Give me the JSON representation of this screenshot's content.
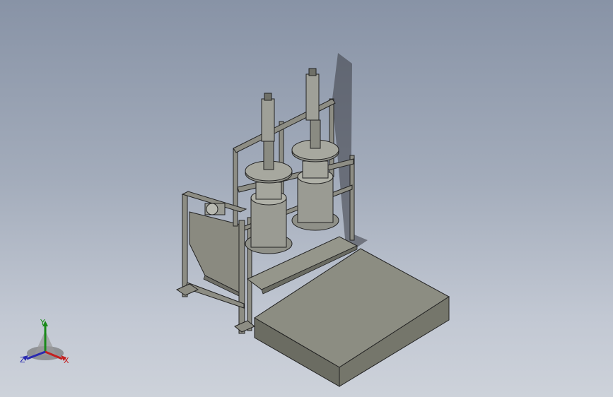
{
  "viewport": {
    "background_top": "#8893a6",
    "background_bottom": "#cdd2da"
  },
  "model": {
    "frame_color": "#7a7a70",
    "body_color": "#8a8b7f",
    "platform_color": "#7e7f73"
  },
  "triad": {
    "x_label": "X",
    "y_label": "Y",
    "z_label": "Z",
    "x_color": "#c42020",
    "y_color": "#1a8a1a",
    "z_color": "#2a2ab0"
  }
}
